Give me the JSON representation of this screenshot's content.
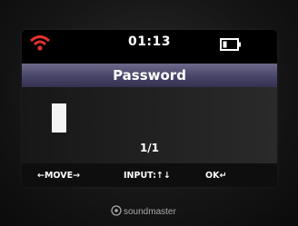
{
  "device": {
    "brand": "soundmaster"
  },
  "status_bar": {
    "time": "01:13",
    "wifi_color": "#e03030",
    "battery_state": "low"
  },
  "dialog": {
    "title": "Password",
    "page_indicator": "1/1"
  },
  "footer": {
    "move_hint": "←MOVE→",
    "input_hint": "INPUT:↑↓",
    "ok_hint": "OK↵"
  },
  "colors": {
    "title_bar": "#4a4768",
    "screen_bg": "#000000",
    "text": "#ffffff"
  }
}
